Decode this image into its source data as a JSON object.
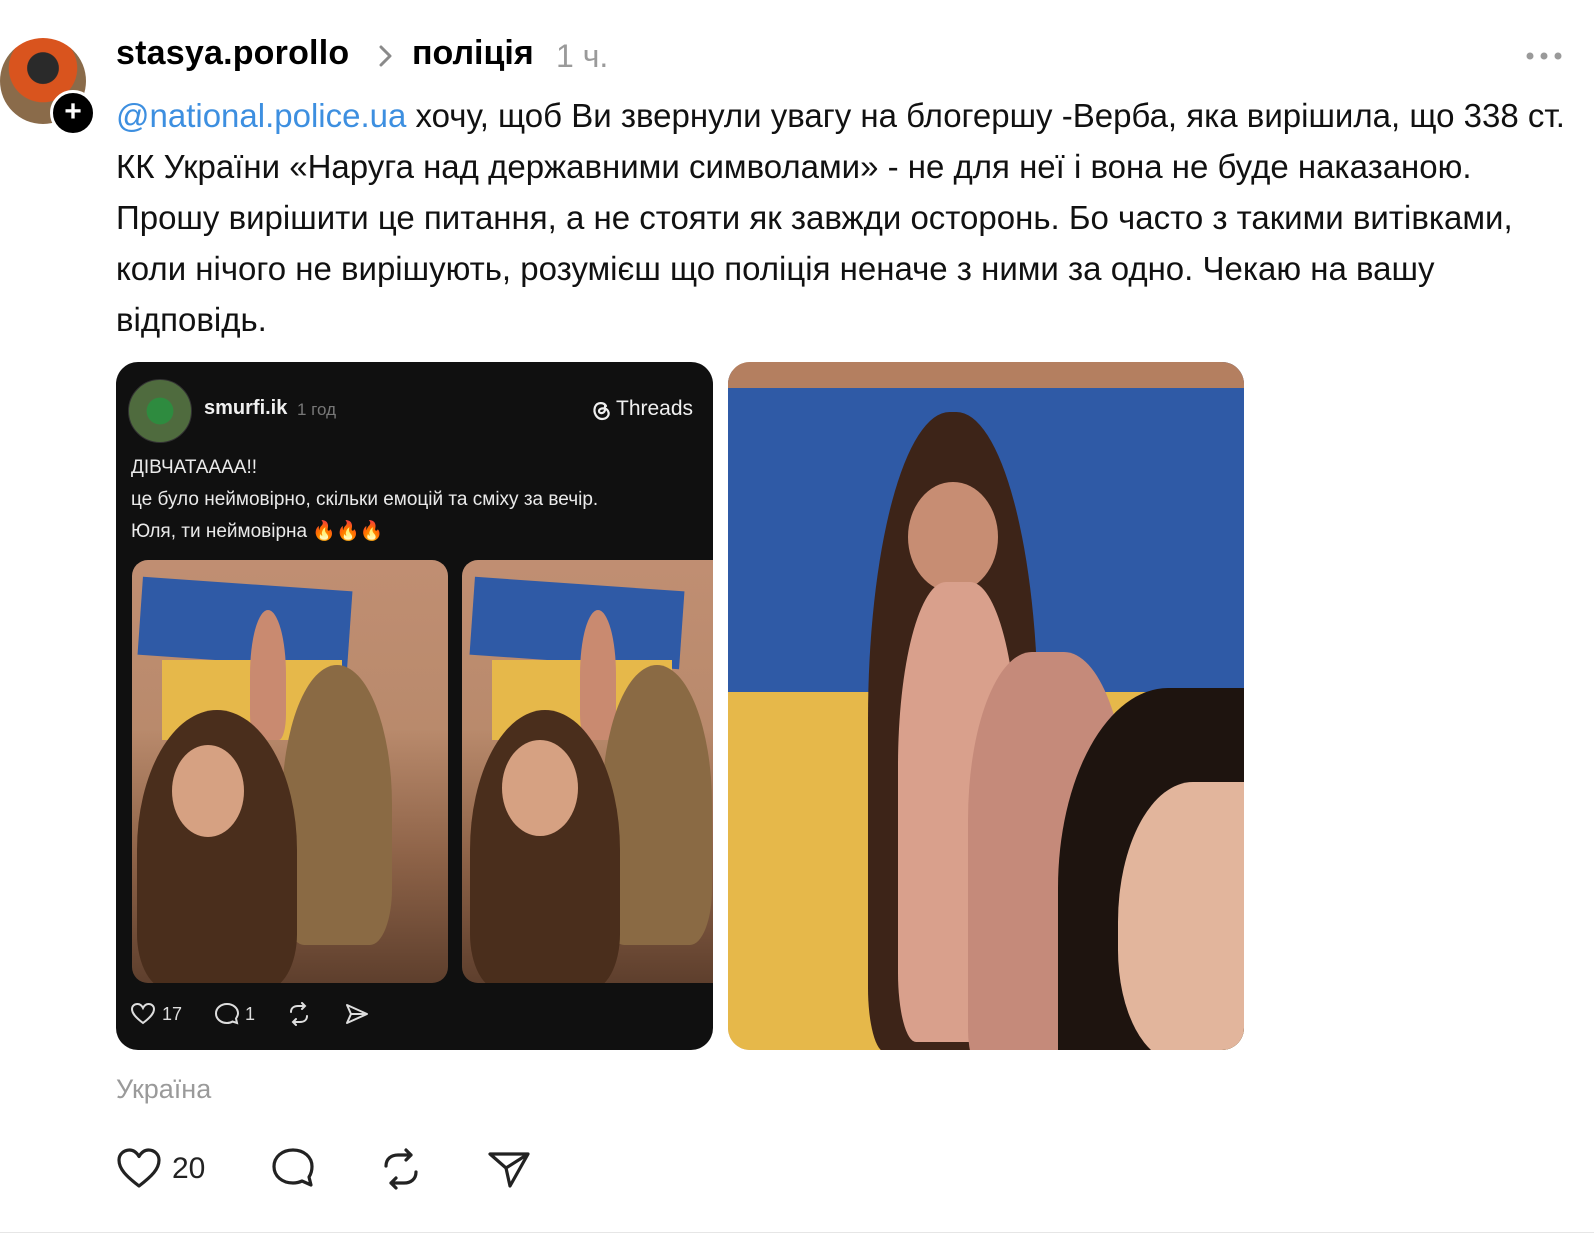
{
  "post": {
    "username": "stasya.porollo",
    "topic": "поліція",
    "time": "1 ч.",
    "mention": "@national.police.ua",
    "text": " хочу, щоб Ви звернули увагу на блогершу -Верба, яка вирішила, що 338 ст. КК України «Наруга над державними символами» - не для неї і вона не буде наказаною. Прошу вирішити це питання, а не стояти як завжди осторонь. Бо часто з такими витівками, коли нічого не вирішують, розумієш що поліція неначе з ними за одно. Чекаю на вашу відповідь.",
    "location": "Україна",
    "likes": "20"
  },
  "embedded": {
    "username": "smurfi.ik",
    "time": "1 год",
    "app": "Threads",
    "line1": "ДІВЧАТАААА!!",
    "line2": "це було неймовірно, скільки емоцій та сміху за вечір.",
    "line3": "Юля, ти неймовірна 🔥🔥🔥",
    "likes": "17",
    "replies": "1"
  },
  "colors": {
    "mention": "#3d8fe0",
    "muted": "#9a9a9a",
    "card_bg": "#101010"
  },
  "icons": [
    "chevron-right-icon",
    "more-icon",
    "heart-icon",
    "comment-icon",
    "repost-icon",
    "share-icon",
    "threads-icon",
    "plus-icon"
  ]
}
